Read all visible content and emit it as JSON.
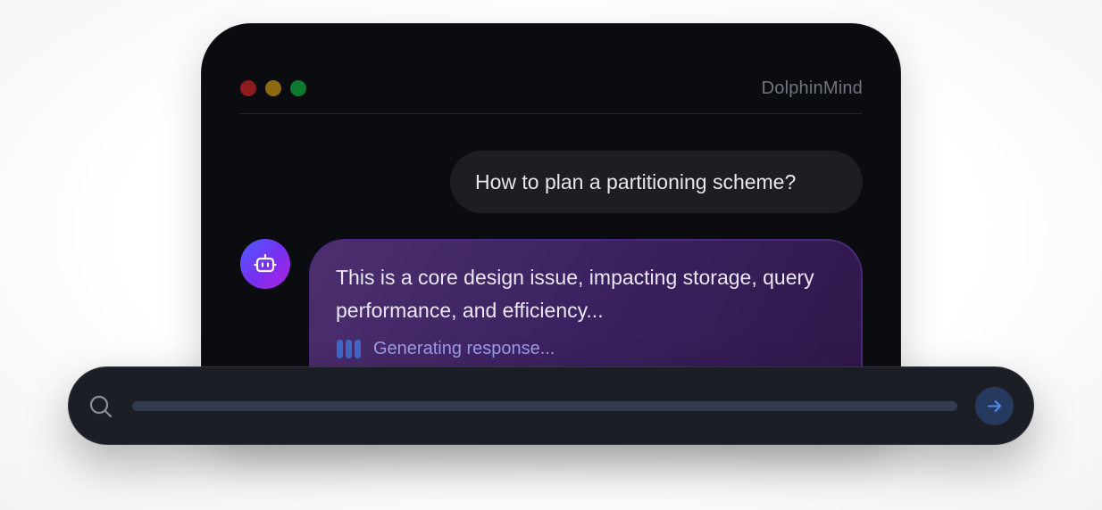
{
  "window": {
    "app_title": "DolphinMind",
    "traffic_lights": {
      "close_color": "#8e1c1e",
      "minimize_color": "#8d6a11",
      "maximize_color": "#0c7a2f"
    }
  },
  "conversation": {
    "user_message": "How to plan a partitioning scheme?",
    "assistant": {
      "avatar_icon": "robot-icon",
      "message": "This is a core design issue, impacting storage, query performance, and efficiency...",
      "status_text": "Generating response..."
    }
  },
  "input_bar": {
    "search_icon": "search-icon",
    "value": "",
    "placeholder": "",
    "send_icon": "arrow-right-icon"
  },
  "colors": {
    "accent_blue": "#4f8cf0",
    "bubble_purple": "#3b2260",
    "status_lavender": "#9b9ae6"
  }
}
